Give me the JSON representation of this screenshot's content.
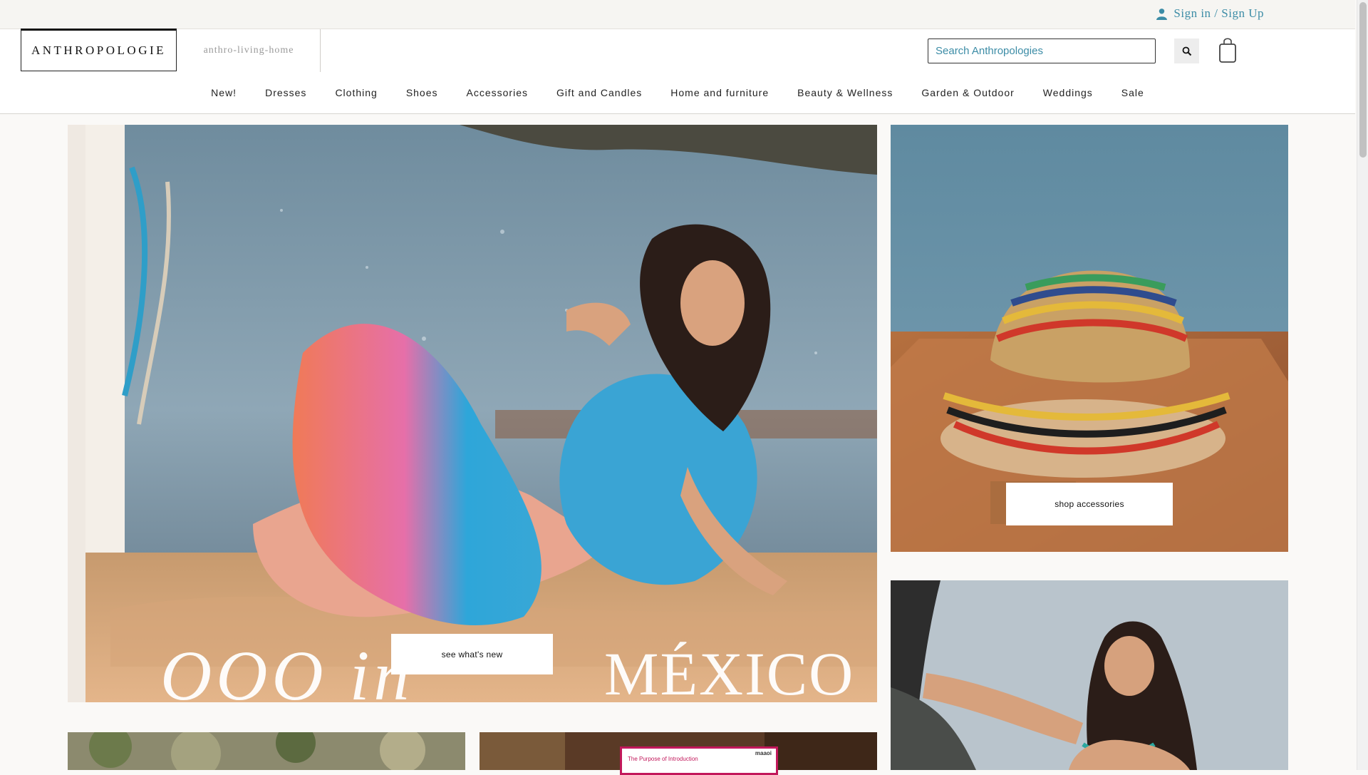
{
  "topbar": {
    "signin_label": "Sign in / Sign Up"
  },
  "header": {
    "logo": "ANTHROPOLOGIE",
    "sub_logo": "anthro-living-home",
    "search_placeholder": "Search Anthropologies"
  },
  "nav": {
    "items": [
      "New!",
      "Dresses",
      "Clothing",
      "Shoes",
      "Accessories",
      "Gift and Candles",
      "Home and furniture",
      "Beauty & Wellness",
      "Garden & Outdoor",
      "Weddings",
      "Sale"
    ]
  },
  "hero": {
    "cta_label": "see what's new",
    "overlay_script": "OOO in",
    "overlay_title": "MÉXICO"
  },
  "accessories": {
    "cta_label": "shop accessories"
  },
  "promo_card": {
    "text": "The Purpose of Introduction",
    "brand": "maaoi"
  },
  "colors": {
    "accent": "#3c8ca6",
    "border": "#333333",
    "promo": "#c2185b"
  }
}
